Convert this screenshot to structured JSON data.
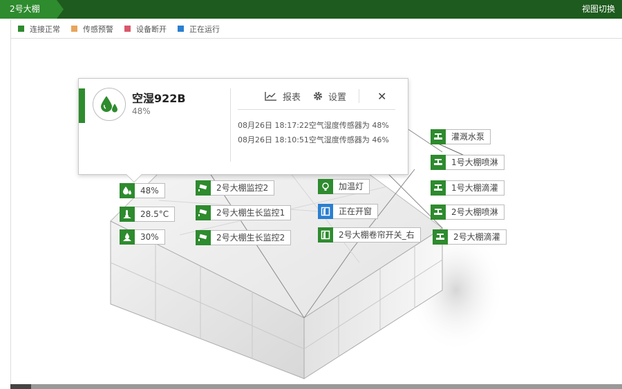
{
  "header": {
    "active_tab": "2号大棚",
    "view_switch": "视图切换"
  },
  "legend": [
    {
      "label": "连接正常",
      "color": "#2e8b2e"
    },
    {
      "label": "传感预警",
      "color": "#e8a55a"
    },
    {
      "label": "设备断开",
      "color": "#d9586a"
    },
    {
      "label": "正在运行",
      "color": "#2a7fd0"
    }
  ],
  "popup": {
    "title": "空湿922B",
    "value": "48%",
    "report_label": "报表",
    "settings_label": "设置",
    "close_label": "✕",
    "logs": [
      "08月26日 18:17:22空气湿度传感器为 48%",
      "08月26日 18:10:51空气湿度传感器为 46%"
    ]
  },
  "sensors": {
    "humidity": "48%",
    "temperature": "28.5°C",
    "soil": "30%"
  },
  "devices": {
    "monitor2": "2号大棚监控2",
    "growth1": "2号大棚生长监控1",
    "growth2": "2号大棚生长监控2",
    "heater": "加温灯",
    "window": "正在开窗",
    "curtain": "2号大棚卷帘开关_右",
    "pump": "灌溉水泵",
    "spray1": "1号大棚喷淋",
    "drip1": "1号大棚滴灌",
    "spray2": "2号大棚喷淋",
    "drip2": "2号大棚滴灌"
  }
}
